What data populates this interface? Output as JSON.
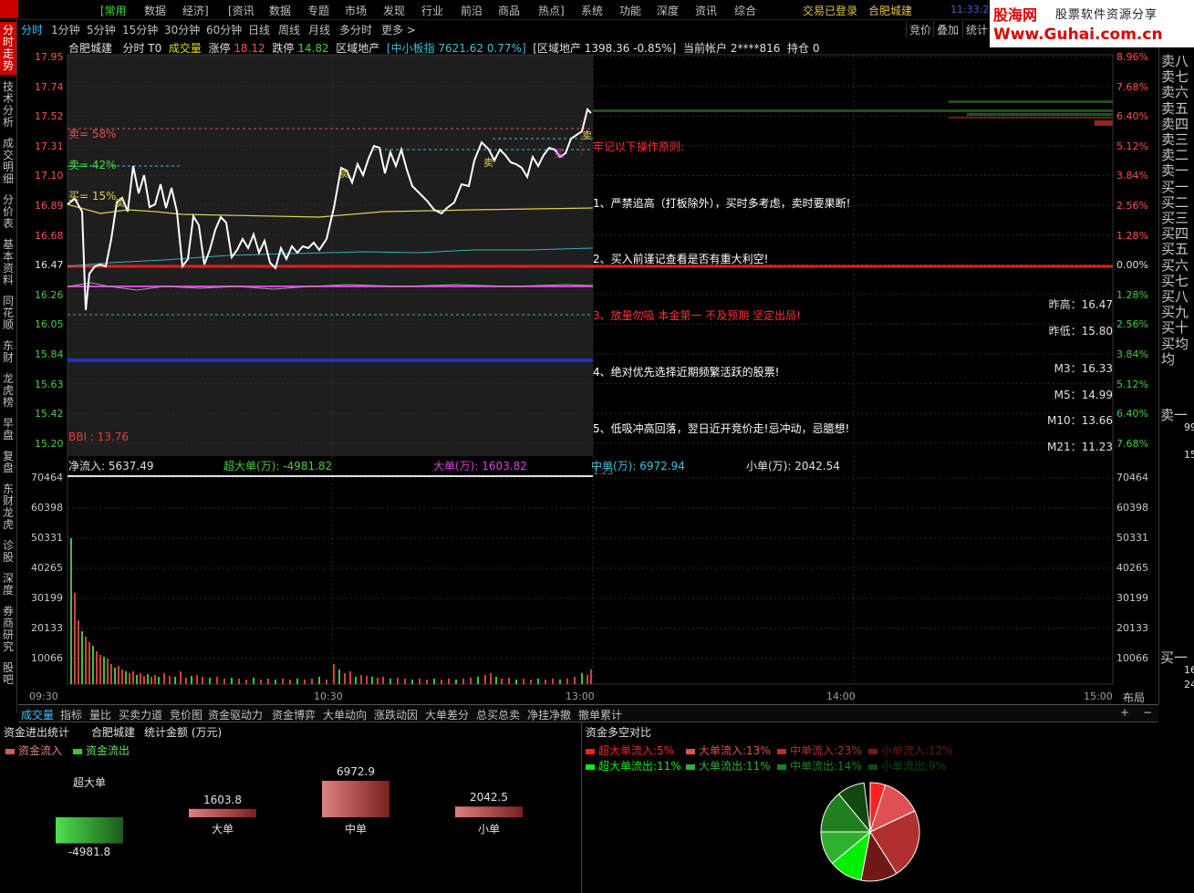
{
  "menubar": {
    "items": [
      "[常用",
      "数据",
      "经济]",
      "[资讯",
      "数据",
      "专题",
      "市场",
      "发现",
      "行业",
      "前沿",
      "商品",
      "热点]",
      "系统",
      "功能",
      "深度",
      "资讯",
      "综合"
    ],
    "login_status": "交易已登录",
    "stock_name": "合肥城建",
    "clock": "11:33:2"
  },
  "brand": {
    "name": "股海网",
    "tagline": "股票软件资源分享",
    "url": "Www.Guhai.com.cn"
  },
  "period_tabs": [
    "分时",
    "1分钟",
    "5分钟",
    "15分钟",
    "30分钟",
    "60分钟",
    "日线",
    "周线",
    "月线",
    "多分时",
    "更多 >"
  ],
  "right_tools": [
    "竞价",
    "叠加",
    "统计"
  ],
  "left_tabs": [
    "分时走势",
    "技术分析",
    "成交明细",
    "分价表",
    "基本资料",
    "同花顺",
    "东财",
    "龙虎榜",
    "早盘",
    "复盘",
    "东财龙虎",
    "诊股",
    "深度",
    "券商研究",
    "股吧"
  ],
  "infobar": {
    "name": "合肥城建",
    "mode": "分时 T0",
    "volume_label": "成交量",
    "limit_up_label": "涨停",
    "limit_up": "18.12",
    "limit_down_label": "跌停",
    "limit_down": "14.82",
    "sector_label": "区域地产",
    "index": "[中小板指 7621.62 0.77%]",
    "sector_index": "[区域地产 1398.36 -0.85%]",
    "account": "当前帐户 2****816",
    "position": "持仓 0"
  },
  "price_axis": [
    "17.95",
    "17.74",
    "17.52",
    "17.31",
    "17.10",
    "16.89",
    "16.68",
    "16.47",
    "16.26",
    "16.05",
    "15.84",
    "15.63",
    "15.42",
    "15.20"
  ],
  "pct_axis": [
    "8.96%",
    "7.68%",
    "6.40%",
    "5.12%",
    "3.84%",
    "2.56%",
    "1.28%",
    "0.00%",
    "1.28%",
    "2.56%",
    "3.84%",
    "5.12%",
    "6.40%",
    "7.68%"
  ],
  "vol_axis": [
    "70464",
    "60398",
    "50331",
    "40265",
    "30199",
    "20133",
    "10066"
  ],
  "time_axis": [
    "09:30",
    "10:30",
    "13:00",
    "14:00",
    "15:00"
  ],
  "chart_labels": {
    "sell_58": "卖= 58%",
    "sell_42": "卖= 42%",
    "buy_15": "买= 15%",
    "bbi": "BBI : 13.76",
    "mark_buy": "买",
    "mark_sell": "卖",
    "time_1323": "1:23"
  },
  "notes": {
    "title": "牢记以下操作原则:",
    "n1": "1、严禁追高（打板除外），买时多考虑，卖时要果断!",
    "n2": "2、买入前谨记查看是否有重大利空!",
    "n3": "3、放量勿吸  本金第一  不及预期  坚定出局!",
    "n4": "4、绝对优先选择近期频繁活跃的股票!",
    "n5": "5、低吸冲高回落，翌日近开竞价走!忌冲动，忌臆想!"
  },
  "stats": {
    "prev_high_label": "昨高：",
    "prev_high": "16.47",
    "prev_low_label": "昨低：",
    "prev_low": "15.80",
    "m3_label": "M3：",
    "m3": "16.33",
    "m5_label": "M5：",
    "m5": "14.99",
    "m10_label": "M10：",
    "m10": "13.66",
    "m21_label": "M21：",
    "m21": "11.23"
  },
  "flow_line": {
    "net": "净流入: 5637.49",
    "super": "超大单(万): -4981.82",
    "large": "大单(万): 1603.82",
    "medium": "中单(万): 6972.94",
    "small": "小单(万): 2042.54"
  },
  "orderbook": [
    "卖八",
    "卖七",
    "卖六",
    "卖五",
    "卖四",
    "卖三",
    "卖二",
    "卖一",
    "买一",
    "买二",
    "买三",
    "买四",
    "买五",
    "买六",
    "买七",
    "买八",
    "买九",
    "买十",
    "买均",
    "均"
  ],
  "orderbook_extra": {
    "sell1": "卖一",
    "sell1_v1": "99",
    "sell1_v2": "15",
    "buy1": "买一",
    "buy1_v1": "16",
    "buy1_v2": "24"
  },
  "bottom_tabs": [
    "成交量",
    "指标",
    "量比",
    "买卖力道",
    "竞价图",
    "资金驱动力",
    "资金博弈",
    "大单动向",
    "涨跌动因",
    "大单差分",
    "总买总卖",
    "净挂净撤",
    "撤单累计"
  ],
  "bottom_controls": {
    "plus": "+",
    "minus": "−",
    "layout": "布局"
  },
  "fund_panel": {
    "title": "资金进出统计",
    "stock": "合肥城建",
    "unit": "统计金额 (万元)",
    "inflow_legend": "资金流入",
    "outflow_legend": "资金流出",
    "bars": [
      {
        "name": "超大单",
        "value": -4981.8,
        "label": "-4981.8"
      },
      {
        "name": "大单",
        "value": 1603.8,
        "label": "1603.8"
      },
      {
        "name": "中单",
        "value": 6972.9,
        "label": "6972.9"
      },
      {
        "name": "小单",
        "value": 2042.5,
        "label": "2042.5"
      }
    ],
    "colors": {
      "in": "#c86060",
      "out": "#40c040"
    }
  },
  "pie_panel": {
    "title": "资金多空对比",
    "legend": [
      {
        "label": "超大单流入:",
        "pct": "5%",
        "color": "#ff2020"
      },
      {
        "label": "大单流入:",
        "pct": "13%",
        "color": "#e05050"
      },
      {
        "label": "中单流入:",
        "pct": "23%",
        "color": "#b03030"
      },
      {
        "label": "小单流入:",
        "pct": "12%",
        "color": "#701818"
      },
      {
        "label": "超大单流出:",
        "pct": "11%",
        "color": "#00ee00"
      },
      {
        "label": "大单流出:",
        "pct": "11%",
        "color": "#30b030"
      },
      {
        "label": "中单流出:",
        "pct": "14%",
        "color": "#208020"
      },
      {
        "label": "小单流出:",
        "pct": "9%",
        "color": "#104810"
      }
    ]
  }
}
